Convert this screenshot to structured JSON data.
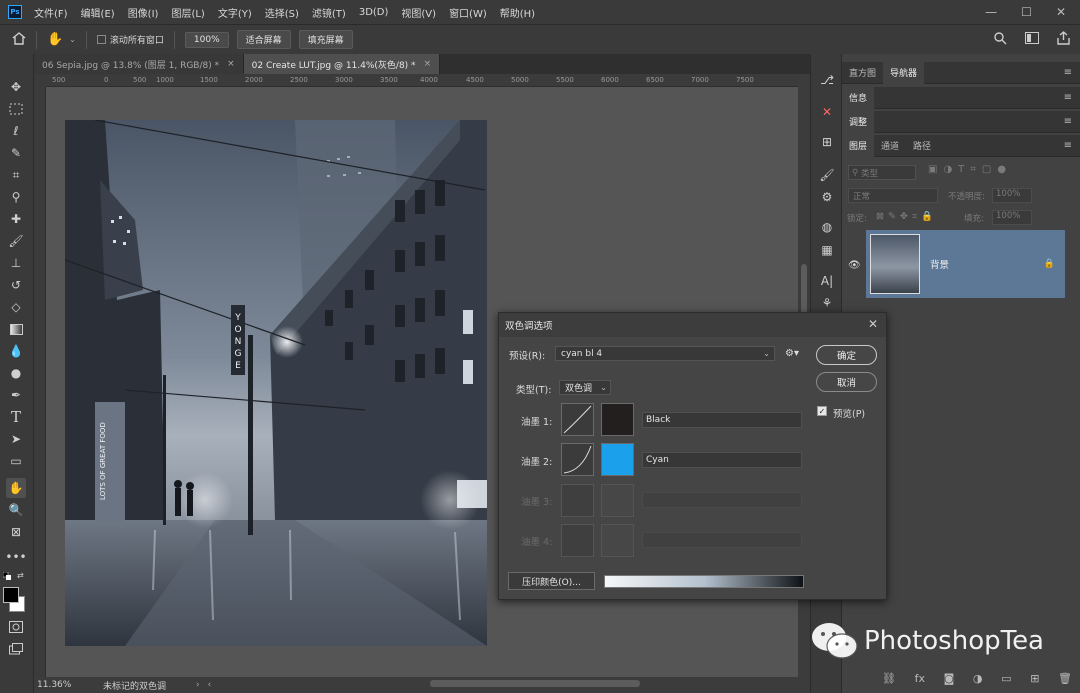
{
  "menubar": {
    "logo": "Ps",
    "items": [
      "文件(F)",
      "编辑(E)",
      "图像(I)",
      "图层(L)",
      "文字(Y)",
      "选择(S)",
      "滤镜(T)",
      "3D(D)",
      "视图(V)",
      "窗口(W)",
      "帮助(H)"
    ]
  },
  "options": {
    "scroll_all": "滚动所有窗口",
    "zoom": "100%",
    "fit_screen": "适合屏幕",
    "fill_screen": "填充屏幕"
  },
  "doc_tabs": [
    {
      "title": "06 Sepia.jpg @ 13.8% (图层 1, RGB/8) *",
      "active": false
    },
    {
      "title": "02 Create LUT.jpg @ 11.4%(灰色/8) *",
      "active": true
    }
  ],
  "ruler_ticks": [
    "500",
    "0",
    "500",
    "1000",
    "1500",
    "2000",
    "2500",
    "3000",
    "3500",
    "4000",
    "4500",
    "5000",
    "5500",
    "6000",
    "6500",
    "7000",
    "7500"
  ],
  "photo_signs": {
    "vertical_sign": "YONGE",
    "storefront": "LOTS OF GREAT FOOD"
  },
  "status": {
    "zoom": "11.36%",
    "doc_info": "未标记的双色调"
  },
  "panels": {
    "top_tabs": [
      "直方图",
      "导航器"
    ],
    "info": "信息",
    "adjust": "调整",
    "layer_tabs": [
      "图层",
      "通道",
      "路径"
    ],
    "kind_search": "类型",
    "blend_mode": "正常",
    "opacity_label": "不透明度:",
    "opacity_value": "100%",
    "lock_label": "锁定:",
    "fill_label": "填充:",
    "fill_value": "100%",
    "layer_name": "背景"
  },
  "dialog": {
    "title": "双色调选项",
    "preset_label": "预设(R):",
    "preset_value": "cyan bl 4",
    "type_label": "类型(T):",
    "type_value": "双色调",
    "ok": "确定",
    "cancel": "取消",
    "preview": "预览(P)",
    "ink1_label": "油墨 1:",
    "ink1_name": "Black",
    "ink1_color": "#231f1e",
    "ink2_label": "油墨 2:",
    "ink2_name": "Cyan",
    "ink2_color": "#1ba0ec",
    "ink3_label": "油墨 3:",
    "ink4_label": "油墨 4:",
    "overprint": "压印颜色(O)..."
  },
  "watermark": "PhotoshopTea"
}
